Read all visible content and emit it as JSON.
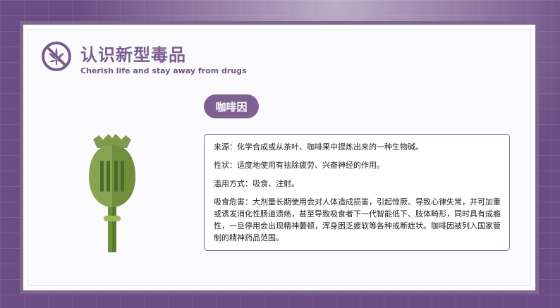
{
  "header": {
    "title": "认识新型毒品",
    "subtitle": "Cherish life and stay away from drugs",
    "logo_icon": "no-cannabis-icon"
  },
  "drug": {
    "name": "咖啡因",
    "illustration_icon": "poppy-pod-icon",
    "details": {
      "source": "来源：化学合成或从茶叶、咖啡果中提炼出来的一种生物碱。",
      "symptoms": "性状：适度地使用有祛除疲劳、兴奋神经的作用。",
      "abuse_method": "滥用方式：吸食、注射。",
      "harm": "吸食危害：大剂量长期使用会对人体造成损害，引起惊厥、导致心律失常，并可加重或诱发消化性肠道溃疡，甚至导致吸食者下一代智能低下、肢体畸形，同时具有成瘾性，一旦停用会出现精神萎顿，浑身困乏疲软等各种戒断症状。咖啡因被列入国家管制的精神药品范围。"
    }
  },
  "colors": {
    "accent": "#7e6190",
    "title": "#7a5d8e",
    "background": "#6c4c84",
    "plant_green": "#7f9c4c",
    "plant_dark": "#4f6b2c"
  }
}
